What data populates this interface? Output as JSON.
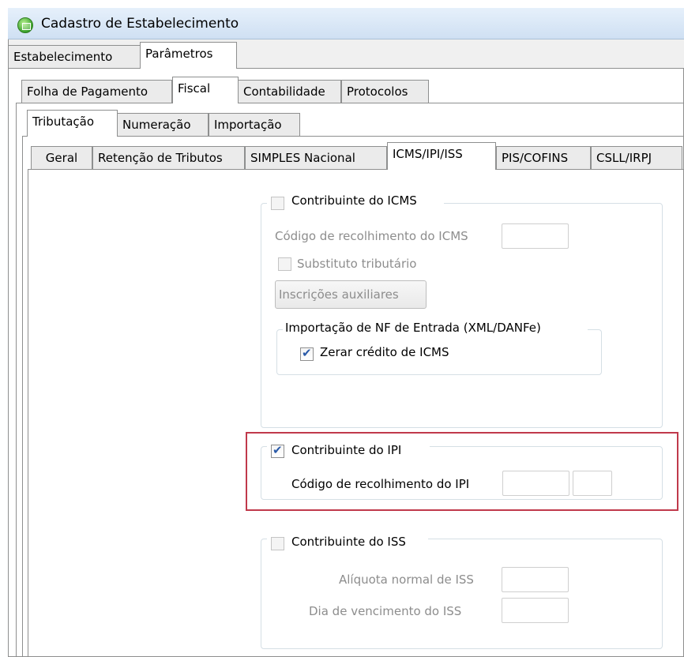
{
  "window": {
    "title": "Cadastro de Estabelecimento"
  },
  "tabs_level1": [
    "Estabelecimento",
    "Parâmetros"
  ],
  "tabs_level2": [
    "Folha de Pagamento",
    "Fiscal",
    "Contabilidade",
    "Protocolos"
  ],
  "tabs_level3": [
    "Tributação",
    "Numeração",
    "Importação"
  ],
  "tabs_level4": [
    "Geral",
    "Retenção de Tributos",
    "SIMPLES Nacional",
    "ICMS/IPI/ISS",
    "PIS/COFINS",
    "CSLL/IRPJ"
  ],
  "icms": {
    "checkbox_label": "Contribuinte do ICMS",
    "checked": false,
    "codigo_label": "Código de recolhimento do ICMS",
    "codigo_value": "",
    "substituto_label": "Substituto tributário",
    "substituto_checked": false,
    "inscricoes_button": "Inscrições auxiliares",
    "importacao": {
      "legend": "Importação de NF de Entrada (XML/DANFe)",
      "zerar_label": "Zerar crédito de ICMS",
      "zerar_checked": true
    }
  },
  "ipi": {
    "checkbox_label": "Contribuinte do IPI",
    "checked": true,
    "codigo_label": "Código de recolhimento do IPI",
    "codigo_value": "",
    "codigo_suffix_value": ""
  },
  "iss": {
    "checkbox_label": "Contribuinte do ISS",
    "checked": false,
    "aliquota_label": "Alíquota normal de ISS",
    "aliquota_value": "",
    "dia_label": "Dia de vencimento do ISS",
    "dia_value": ""
  },
  "colors": {
    "highlight": "#c0394b",
    "check": "#2a5aa8"
  }
}
